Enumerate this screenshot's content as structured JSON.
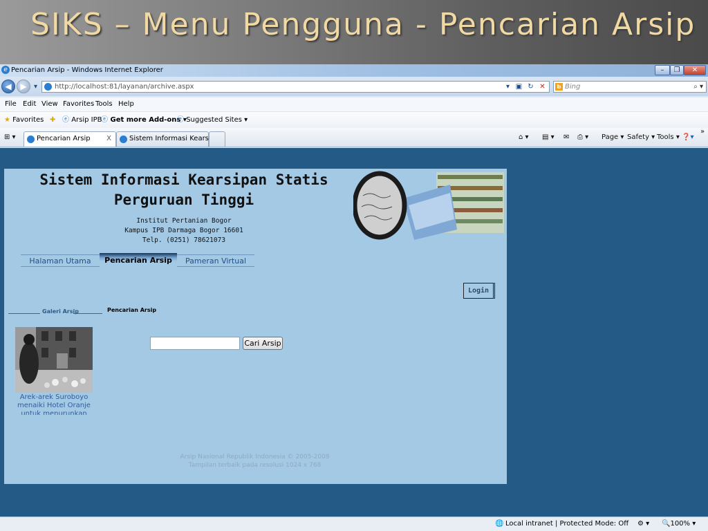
{
  "slide": {
    "title": "SIKS – Menu Pengguna - Pencarian Arsip"
  },
  "browser": {
    "window_title": "Pencarian Arsip - Windows Internet Explorer",
    "address": "http://localhost:81/layanan/archive.aspx",
    "search_placeholder": "Bing",
    "menu": [
      "File",
      "Edit",
      "View",
      "Favorites",
      "Tools",
      "Help"
    ],
    "favorites": {
      "label": "Favorites",
      "items": [
        "Arsip IPB",
        "Get more Add-ons ▾",
        "Suggested Sites ▾"
      ]
    },
    "tabs": [
      {
        "label": "Pencarian Arsip",
        "close": "X"
      },
      {
        "label": "Sistem Informasi Kearsipa..."
      }
    ],
    "commands": [
      "Page ▾",
      "Safety ▾",
      "Tools ▾"
    ],
    "status": {
      "zone": "Local intranet | Protected Mode: Off",
      "zoom": "100%"
    }
  },
  "site": {
    "title_line1": "Sistem Informasi Kearsipan Statis",
    "title_line2": "Perguruan Tinggi",
    "institution": "Institut Pertanian Bogor",
    "campus": "Kampus IPB Darmaga Bogor 16601",
    "phone": "Telp. (0251) 78621073",
    "nav": [
      "Halaman Utama",
      "Pencarian Arsip",
      "Pameran Virtual"
    ],
    "login_label": "Login",
    "galeri_label": "Galeri Arsip",
    "pencarian_label": "Pencarian Arsip",
    "photo_caption": "Arek-arek Suroboyo menaiki Hotel Oranje untuk menurunkan",
    "search_button": "Cari Arsip",
    "search_value": "",
    "footer_line1": "Arsip Nasional Republik Indonesia © 2005-2008",
    "footer_line2": "Tampilan terbaik pada resolusi 1024 x 768"
  },
  "colors": {
    "page_bg": "#a4c9e5",
    "outer_bg": "#235a86",
    "slide_title": "#f1d9a4"
  }
}
